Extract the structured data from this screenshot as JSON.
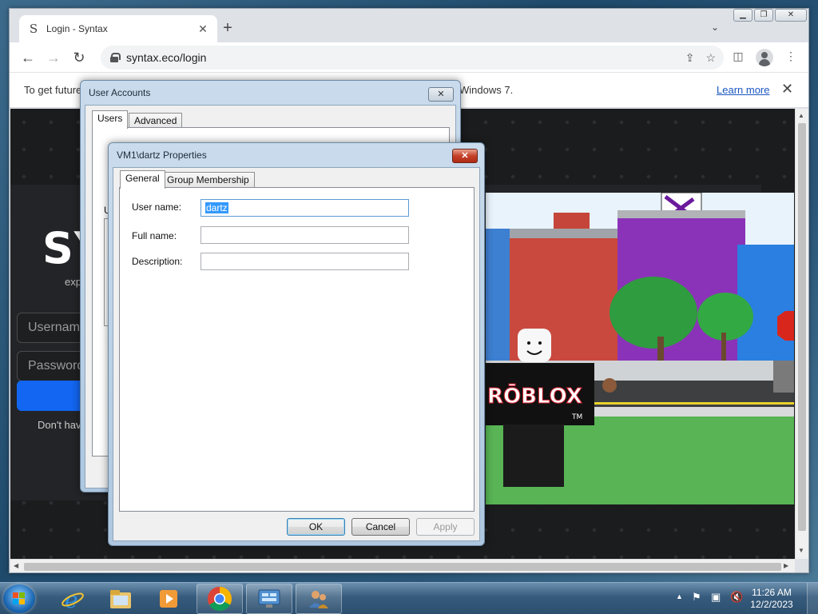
{
  "browser": {
    "tab_title": "Login - Syntax",
    "tab_favicon": "S",
    "url": "syntax.eco/login",
    "infobar_text": "To get future",
    "infobar_text_right": "Windows 7.",
    "learn_more": "Learn more"
  },
  "page": {
    "brand": "SY",
    "brand_sub": "exp",
    "username_placeholder": "Username",
    "password_placeholder": "Password",
    "signup_text": "Don't hav"
  },
  "user_accounts": {
    "title": "User Accounts",
    "tabs": [
      "Users",
      "Advanced"
    ],
    "panel_letter": "U"
  },
  "properties": {
    "title": "VM1\\dartz Properties",
    "tabs": [
      "General",
      "Group Membership"
    ],
    "fields": {
      "username_label": "User name:",
      "username_value": "dartz",
      "fullname_label": "Full name:",
      "fullname_value": "",
      "description_label": "Description:",
      "description_value": ""
    },
    "buttons": {
      "ok": "OK",
      "cancel": "Cancel",
      "apply": "Apply"
    }
  },
  "taskbar": {
    "time": "11:26 AM",
    "date": "12/2/2023"
  },
  "colors": {
    "accent_blue": "#1266f1",
    "selection": "#3399ff"
  }
}
